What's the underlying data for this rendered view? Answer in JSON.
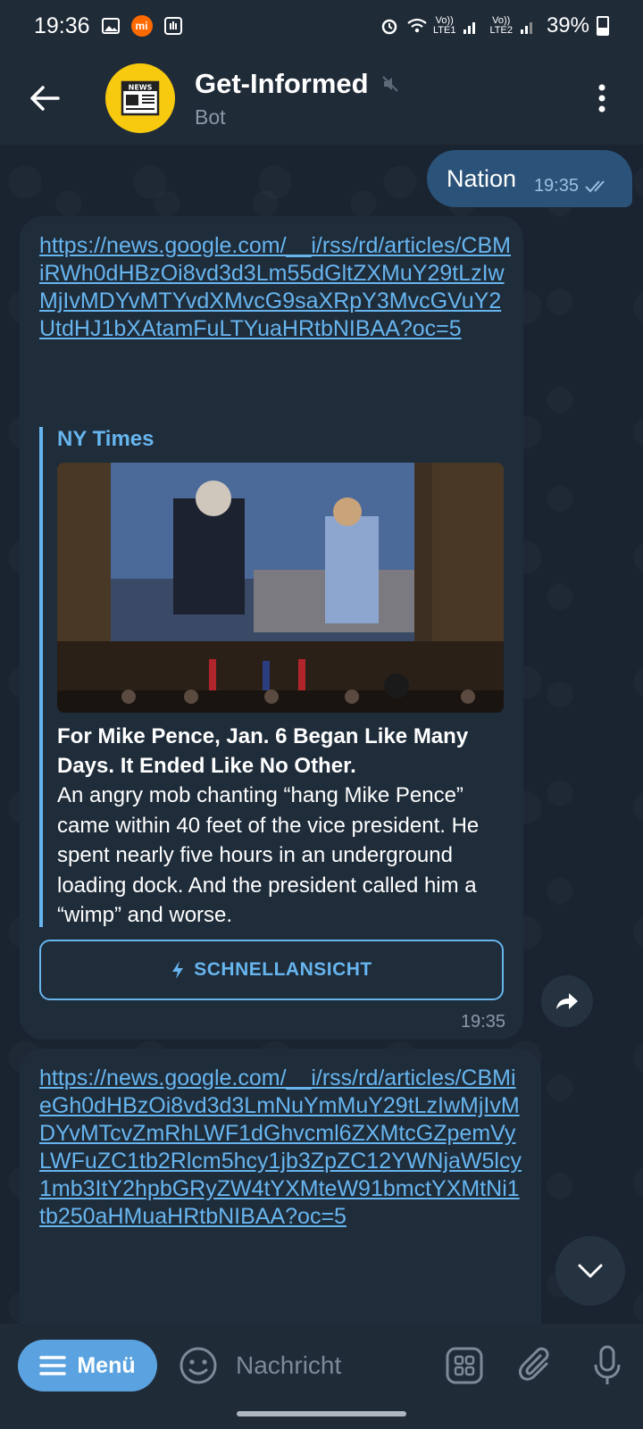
{
  "status_bar": {
    "time": "19:36",
    "battery": "39%",
    "sim1_top": "Vo))",
    "sim1_bottom": "LTE1",
    "sim2_top": "Vo))",
    "sim2_bottom": "LTE2",
    "icons": [
      "gallery-icon",
      "mi-icon",
      "gesture-icon",
      "alarm-icon",
      "wifi-icon",
      "signal-icon",
      "battery-icon"
    ]
  },
  "header": {
    "title": "Get-Informed",
    "subtitle": "Bot",
    "avatar_text": "NEWS"
  },
  "messages": {
    "outgoing": {
      "text": "Nation",
      "time": "19:35"
    },
    "incoming1": {
      "link": "https://news.google.com/__i/rss/rd/articles/CBMiRWh0dHBzOi8vd3d3Lm55dGltZXMuY29tLzIwMjIvMDYvMTYvdXMvcG9saXRpY3MvcGVuY2UtdHJ1bXAtamFuLTYuaHRtbNIBAA?oc=5",
      "preview_site": "NY Times",
      "preview_title": "For Mike Pence, Jan. 6 Began Like Many Days. It Ended Like No Other.",
      "preview_desc": "An angry mob chanting “hang Mike Pence” came within 40 feet of the vice president. He spent nearly five hours in an underground loading dock. And the president called him a “wimp” and worse.",
      "quick_view_label": "SCHNELLANSICHT",
      "time": "19:35"
    },
    "incoming2": {
      "link": "https://news.google.com/__i/rss/rd/articles/CBMieGh0dHBzOi8vd3d3LmNuYmMuY29tLzIwMjIvMDYvMTcvZmRhLWF1dGhvcml6ZXMtcGZpemVyLWFuZC1tb2Rlcm5hcy1jb3ZpZC12YWNjaW5lcy1mb3ItY2hpbGRyZW4tYXMteW91bmctYXMtNi1tb250aHMuaHRtbNIBAA?oc=5"
    }
  },
  "input_bar": {
    "menu_label": "Menü",
    "placeholder": "Nachricht"
  },
  "colors": {
    "accent": "#67b5ef",
    "outgoing_bubble": "#2b5278",
    "incoming_bubble": "#1f2c3a",
    "header_bg": "#202b38",
    "avatar_bg": "#f7c90f",
    "menu_button": "#5aa3e0"
  }
}
